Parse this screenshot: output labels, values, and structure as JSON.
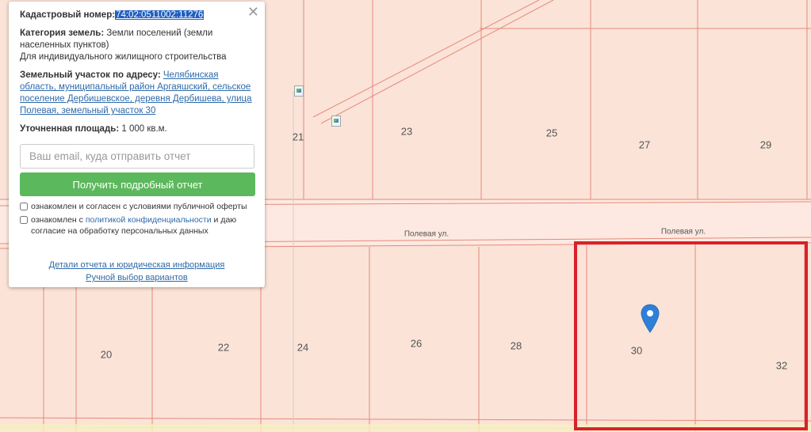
{
  "map": {
    "plots": [
      {
        "id": "p21",
        "label": "21"
      },
      {
        "id": "p23",
        "label": "23"
      },
      {
        "id": "p25",
        "label": "25"
      },
      {
        "id": "p27",
        "label": "27"
      },
      {
        "id": "p29",
        "label": "29"
      },
      {
        "id": "p20",
        "label": "20"
      },
      {
        "id": "p22",
        "label": "22"
      },
      {
        "id": "p24",
        "label": "24"
      },
      {
        "id": "p26",
        "label": "26"
      },
      {
        "id": "p28",
        "label": "28"
      },
      {
        "id": "p30",
        "label": "30"
      },
      {
        "id": "p32",
        "label": "32"
      }
    ],
    "streets": [
      {
        "id": "street-1",
        "label": "Полевая ул."
      },
      {
        "id": "street-2",
        "label": "Полевая ул."
      }
    ],
    "colors": {
      "parcel_fill": "#fbe3d8",
      "parcel_border": "#e58a78",
      "highlight": "#d9212a",
      "pin": "#2f7fd6"
    },
    "selected_plot": "30"
  },
  "popup": {
    "cad_label": "Кадастровый номер:",
    "cad_value": "74:02:0511002:11276",
    "category_label": "Категория земель:",
    "category_value": "Земли поселений (земли населенных пунктов)",
    "usage": "Для индивидуального жилищного строительства",
    "address_label": "Земельный участок по адресу:",
    "address_value": "Челябинская область, муниципальный район Аргаяшский, сельское поселение Дербишевское, деревня Дербишева, улица Полевая, земельный участок 30",
    "area_label": "Уточненная площадь:",
    "area_value": "1 000 кв.м.",
    "email_placeholder": "Ваш email, куда отправить отчет",
    "button_label": "Получить подробный отчет",
    "check1_text": "ознакомлен и согласен с условиями публичной оферты",
    "check2_prefix": "ознакомлен с",
    "check2_link": "политикой конфиденциальности",
    "check2_suffix": "и даю согласие на обработку персональных данных",
    "link_details": "Детали отчета и юридическая информация",
    "link_manual": "Ручной выбор вариантов",
    "close_symbol": "✕"
  }
}
